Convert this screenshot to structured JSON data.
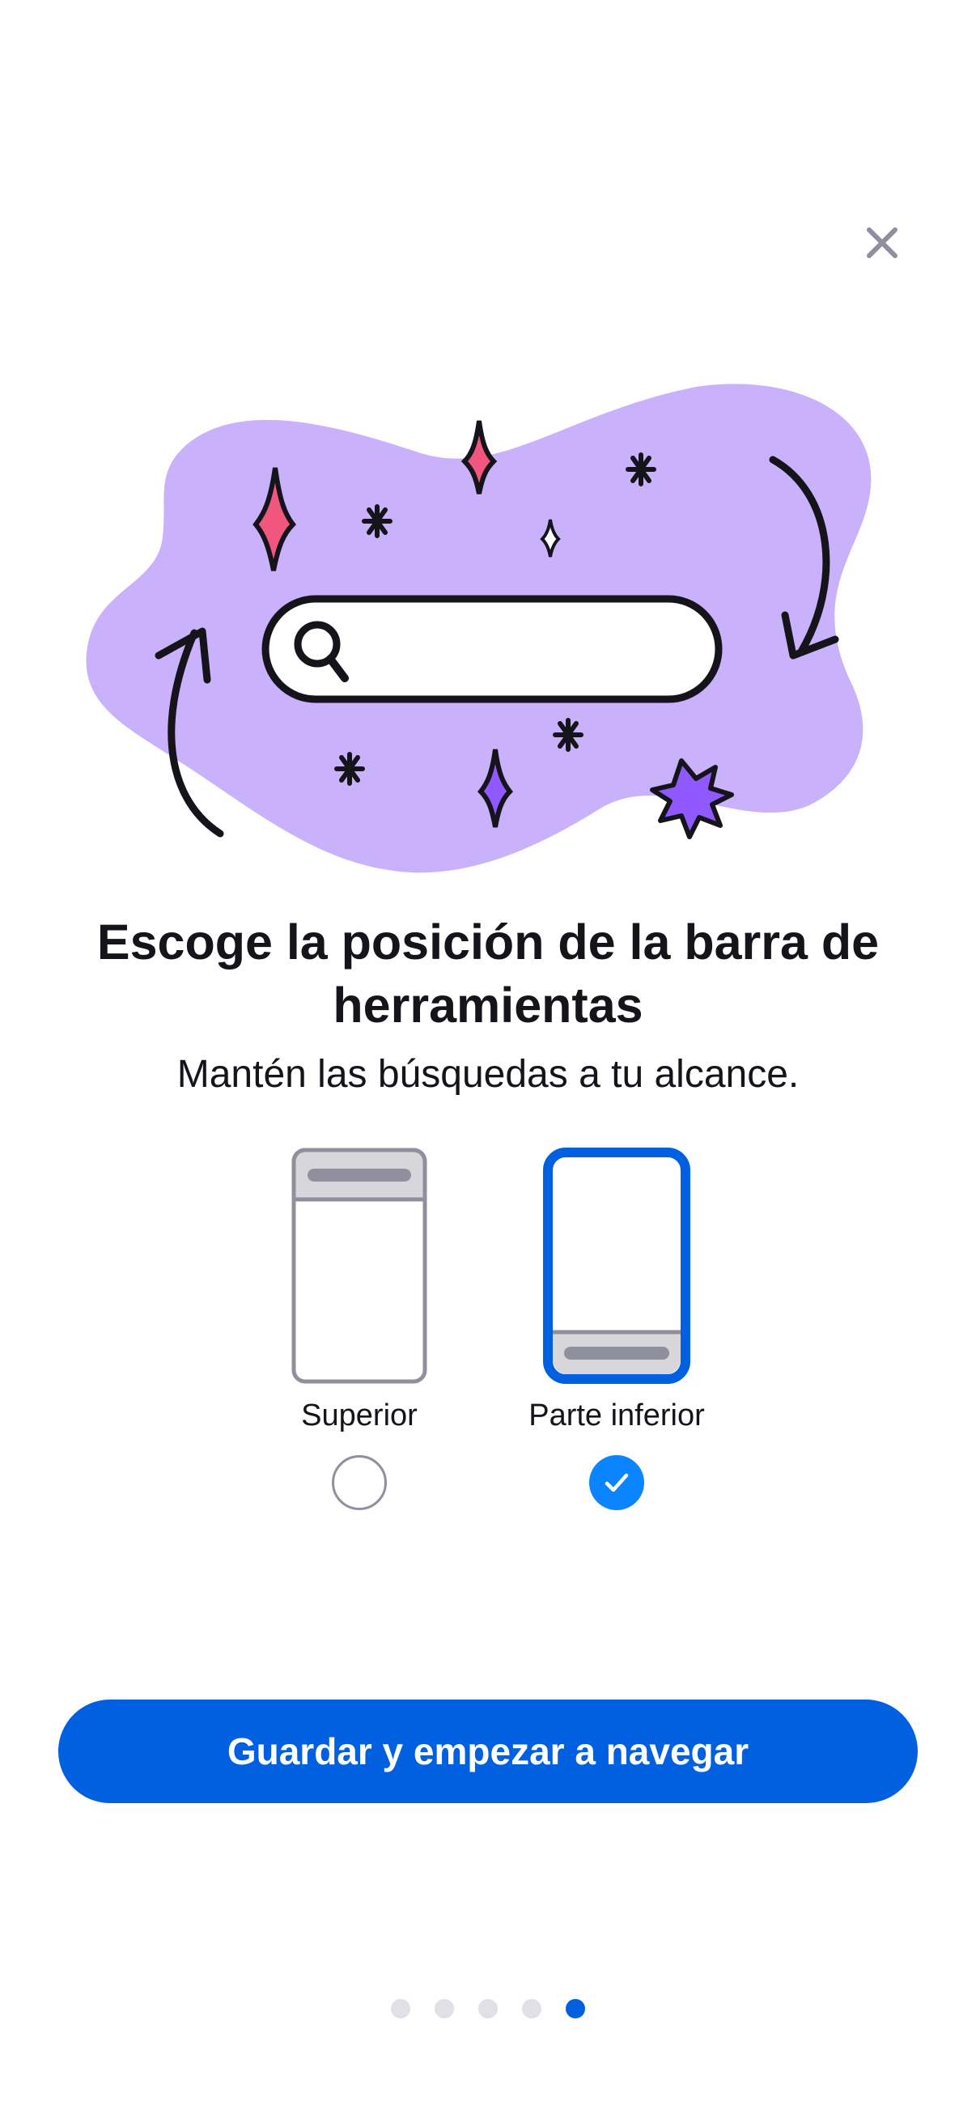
{
  "close": {
    "icon": "close-icon"
  },
  "illustration": {
    "icon": "search-bar-illustration",
    "blob_color": "#c9b1fb",
    "accent_pink": "#f1577e",
    "accent_purple": "#9059ff"
  },
  "heading": {
    "title": "Escoge la posición de la barra de herramientas",
    "subtitle": "Mantén las búsquedas a tu alcance."
  },
  "options": [
    {
      "label": "Superior",
      "selected": false
    },
    {
      "label": "Parte inferior",
      "selected": true
    }
  ],
  "cta": {
    "label": "Guardar y empezar a navegar"
  },
  "pager": {
    "total": 5,
    "current": 5
  },
  "colors": {
    "primary": "#0060df",
    "radio_on": "#0a84ff",
    "text": "#15141a",
    "muted": "#8f8f9d"
  }
}
